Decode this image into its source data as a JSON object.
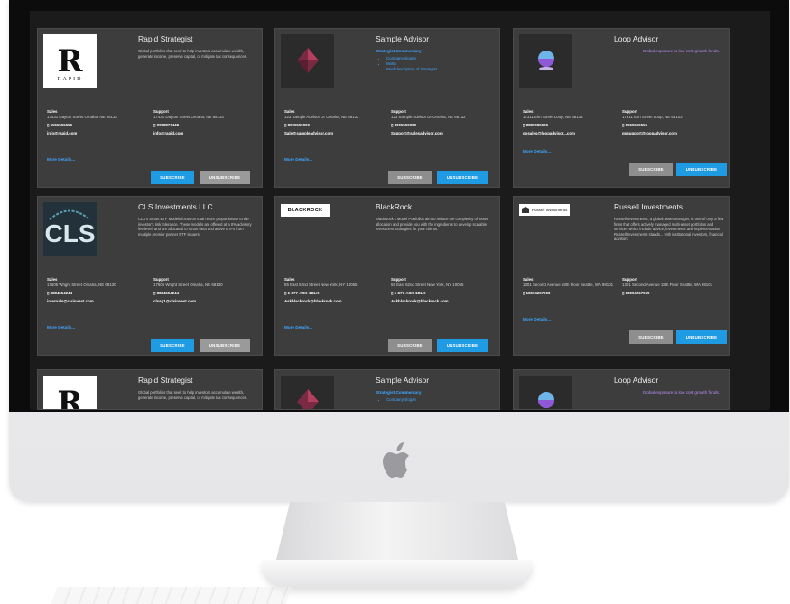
{
  "cards": [
    {
      "title": "Rapid Strategist",
      "logo_text": "RAPID",
      "description": "Global portfolios that seek to help investors accumulate wealth, generate income, preserve capital, or mitigate tax consequences.",
      "sales": {
        "label": "Sales",
        "address": "17431 Dayton Street Omaha, NE 68133",
        "phone": "▯ 5555555555",
        "email": "info@rapid.com"
      },
      "support": {
        "label": "Support",
        "address": "17431 Dayton Street Omaha, NE 68133",
        "phone": "▯ 9958877448",
        "email": "info@rapid.com"
      },
      "more": "More Details...",
      "subscribe": "SUBSCRIBE",
      "unsubscribe": "UNSUBSCRIBE",
      "subscribed": false
    },
    {
      "title": "Sample Advisor",
      "subtitle": "Strategist Commentary",
      "bullets": [
        "Company slogan",
        "Motto",
        "Brief description of Strategist"
      ],
      "sales": {
        "label": "Sales",
        "address": "123 Sample Advisor Dr Omaha, NE 68132",
        "phone": "▯ 8005559999",
        "email": "Sale@sampleadvisor.com"
      },
      "support": {
        "label": "Support",
        "address": "123 Sample Advisor Dr Omaha, NE 68132",
        "phone": "▯ 8005559999",
        "email": "Support@salesadvisor.com"
      },
      "more": "More Details...",
      "subscribe": "SUBSCRIBE",
      "unsubscribe": "UNSUBSCRIBE",
      "subscribed": true
    },
    {
      "title": "Loop Advisor",
      "tagline": "Global exposure to low cost growth funds.",
      "sales": {
        "label": "Sales",
        "address": "17311 Elm Street Loop, NE 68133",
        "phone": "▯ 8889985525",
        "email": "gosales@loopadvisor...com"
      },
      "support": {
        "label": "Support",
        "address": "17311 Elm Street Loop, NE 68133",
        "phone": "▯ 5555555555",
        "email": "gosupport@loopadvisor.com"
      },
      "more": "More Details...",
      "subscribe": "SUBSCRIBE",
      "unsubscribe": "UNSUBSCRIBE",
      "subscribed": true
    },
    {
      "title": "CLS Investments LLC",
      "logo_text": "CLS",
      "description": "CLS's Smart ETF Models focus on total return proportionate to the investor's risk tolerance. These models are offered at a 0% advisory fee level, and are allocated to smart beta and active ETFs from multiple premier partner ETF issuers.",
      "sales": {
        "label": "Sales",
        "address": "17605 Wright Street Omaha, NE 68130",
        "phone": "▯ 8884554244",
        "email": "internals@clsinvest.com"
      },
      "support": {
        "label": "Support",
        "address": "17605 Wright Street Omaha, NE 68130",
        "phone": "▯ 8884554244",
        "email": "clssg1@clsinvest.com"
      },
      "more": "More Details...",
      "subscribe": "SUBSCRIBE",
      "unsubscribe": "UNSUBSCRIBE",
      "subscribed": false
    },
    {
      "title": "BlackRock",
      "logo_text": "BLACKROCK",
      "description": "BlackRock's Model Portfolios aim to reduce the complexity of asset allocation and provide you with the ingredients to develop scalable investment strategies for your clients.",
      "sales": {
        "label": "Sales",
        "address": "55 East 52nd Street New York, NY 10055",
        "phone": "▯ 1-877-ASK-1BLK",
        "email": "Askblackrock@blackrock.com"
      },
      "support": {
        "label": "Support",
        "address": "55 East 52nd Street New York, NY 10055",
        "phone": "▯ 1-877-ASK-1BLK",
        "email": "Askblackrock@blackrock.com"
      },
      "more": "More Details...",
      "subscribe": "SUBSCRIBE",
      "unsubscribe": "UNSUBSCRIBE",
      "subscribed": true
    },
    {
      "title": "Russell Investments",
      "logo_text": "Russell Investments",
      "description": "Russell Investments, a global asset manager, is one of only a few firms that offers actively managed multi-asset portfolios and services which include advice, investments and implementation. Russell Investments stands... with institutional investors, financial advisors",
      "sales": {
        "label": "Sales",
        "address": "1301 Second Avenue 18th Floor Seattle, WA 98101",
        "phone": "▯ 18004267969",
        "email": ""
      },
      "support": {
        "label": "Support",
        "address": "1301 Second Avenue 18th Floor Seattle, WA 98101",
        "phone": "▯ 18004267969",
        "email": ""
      },
      "more": "More Details...",
      "subscribe": "SUBSCRIBE",
      "unsubscribe": "UNSUBSCRIBE",
      "subscribed": true
    },
    {
      "title": "Rapid Strategist",
      "description": "Global portfolios that seek to help investors accumulate wealth, generate income, preserve capital, or mitigate tax consequences."
    },
    {
      "title": "Sample Advisor",
      "subtitle": "Strategist Commentary",
      "bullets": [
        "Company slogan"
      ]
    },
    {
      "title": "Loop Advisor",
      "tagline": "Global exposure to low cost growth funds."
    }
  ],
  "colors": {
    "card_bg": "#3d3d3d",
    "screen_bg": "#1b1b1b",
    "accent_blue": "#1e9be3",
    "link_blue": "#3fa6ff",
    "tagline_purple": "#b98ef7",
    "disabled_gray": "#8e8e8e"
  },
  "icons": {
    "monitor_logo": "apple-logo-icon",
    "phone": "phone-icon"
  }
}
